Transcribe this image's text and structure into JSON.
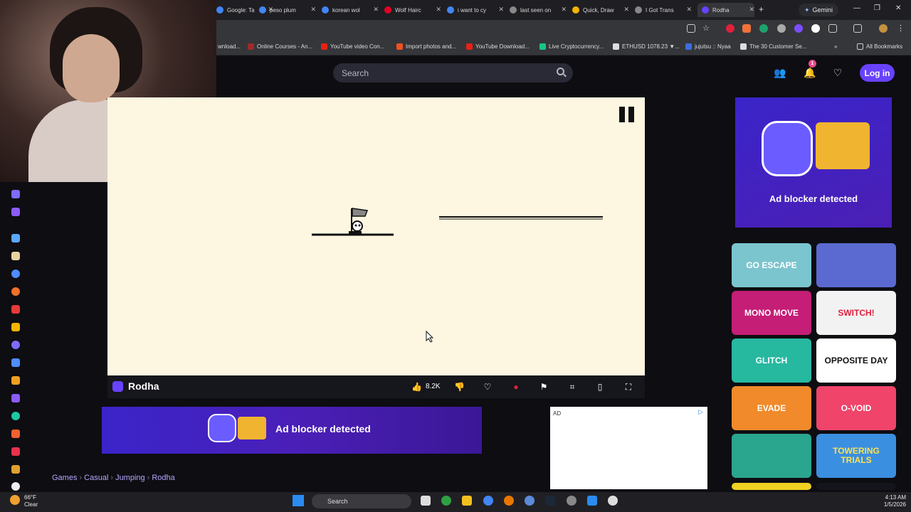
{
  "browser": {
    "tabs": [
      {
        "label": "Google: Ta",
        "fav": "#4285f4"
      },
      {
        "label": "peso plum",
        "fav": "#4285f4"
      },
      {
        "label": "korean wol",
        "fav": "#4285f4"
      },
      {
        "label": "Wolf Hairc",
        "fav": "#e60023"
      },
      {
        "label": "i want to cy",
        "fav": "#4285f4"
      },
      {
        "label": "last seen on",
        "fav": "#888888"
      },
      {
        "label": "Quick, Draw",
        "fav": "#f4b400"
      },
      {
        "label": "I Got Trans",
        "fav": "#888888"
      },
      {
        "label": "Rodha",
        "fav": "#6842ff"
      }
    ],
    "gemini_label": "Gemini",
    "bookmarks": [
      {
        "label": "wnload...",
        "color": "#888888"
      },
      {
        "label": "Online Courses - An...",
        "color": "#a12a2a"
      },
      {
        "label": "YouTube video Con...",
        "color": "#e62117"
      },
      {
        "label": "Import photos and...",
        "color": "#f25022"
      },
      {
        "label": "YouTube Download...",
        "color": "#e62117"
      },
      {
        "label": "Live Cryptocurrency...",
        "color": "#16c784"
      },
      {
        "label": "ETHUSD 1078.23 ▼...",
        "color": "#dddddd"
      },
      {
        "label": "jujutsu :: Nyaa",
        "color": "#3b6ee0"
      },
      {
        "label": "The 30 Customer Se...",
        "color": "#dddddd"
      }
    ],
    "all_bookmarks": "All Bookmarks"
  },
  "site": {
    "search_placeholder": "Search",
    "notification_count": "1",
    "login_label": "Log in"
  },
  "game": {
    "title": "Rodha",
    "likes": "8.2K"
  },
  "ads": {
    "banner_text": "Ad blocker detected",
    "box_label": "AD",
    "right_text": "Ad blocker detected"
  },
  "breadcrumb": [
    "Games",
    "Casual",
    "Jumping",
    "Rodha"
  ],
  "thumbnails": [
    {
      "label": "GO ESCAPE",
      "bg": "#7bc5cf",
      "fg": "#ffffff"
    },
    {
      "label": "",
      "bg": "#5b6ad0",
      "fg": "#ffffff"
    },
    {
      "label": "MONO MOVE",
      "bg": "#c41e76",
      "fg": "#ffffff"
    },
    {
      "label": "SWITCH!",
      "bg": "#f2f2f2",
      "fg": "#e01e3c"
    },
    {
      "label": "GLITCH",
      "bg": "#27b8a0",
      "fg": "#ffffff"
    },
    {
      "label": "OPPOSITE DAY",
      "bg": "#ffffff",
      "fg": "#111111"
    },
    {
      "label": "EVADE",
      "bg": "#f08a2a",
      "fg": "#ffffff"
    },
    {
      "label": "O-VOID",
      "bg": "#f0446a",
      "fg": "#ffffff"
    },
    {
      "label": "",
      "bg": "#2aa58e",
      "fg": "#ffffff"
    },
    {
      "label": "TOWERING TRIALS",
      "bg": "#3b8fe0",
      "fg": "#ffe14d"
    }
  ],
  "taskbar": {
    "temp": "66°F",
    "condition": "Clear",
    "search": "Search",
    "time": "4:13 AM",
    "date": "1/5/2026"
  }
}
